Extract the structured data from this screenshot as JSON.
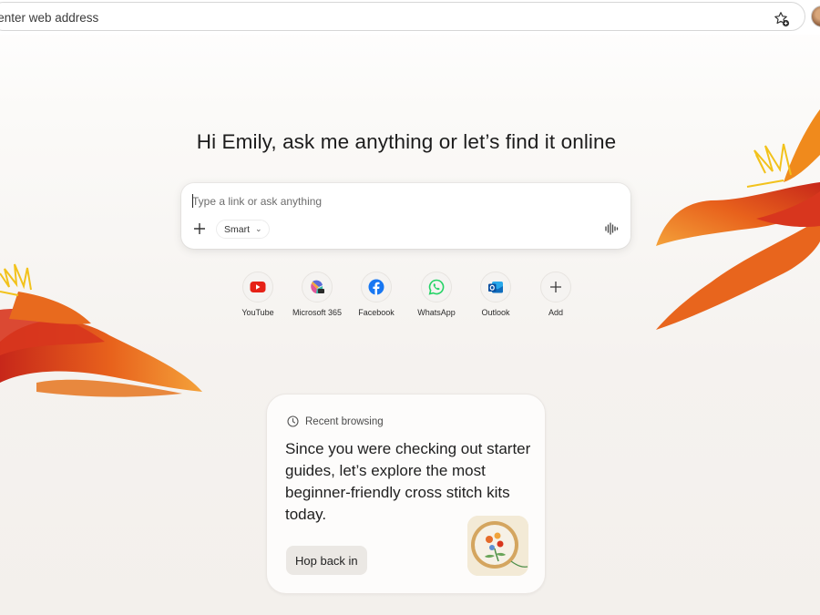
{
  "address_bar": {
    "text": "r enter web address"
  },
  "greeting": "Hi Emily, ask me anything or let’s find it online",
  "ask": {
    "placeholder": "Type a link or ask anything",
    "mode_label": "Smart"
  },
  "shortcuts": [
    {
      "label": "YouTube",
      "icon": "youtube-icon",
      "color": "#e62117"
    },
    {
      "label": "Microsoft 365",
      "icon": "microsoft-365-icon",
      "color": "#7b5cd6"
    },
    {
      "label": "Facebook",
      "icon": "facebook-icon",
      "color": "#1877f2"
    },
    {
      "label": "WhatsApp",
      "icon": "whatsapp-icon",
      "color": "#25d366"
    },
    {
      "label": "Outlook",
      "icon": "outlook-icon",
      "color": "#0f6cbd"
    },
    {
      "label": "Add",
      "icon": "plus-icon",
      "color": "#3a3a3a"
    }
  ],
  "recent": {
    "heading": "Recent browsing",
    "message": "Since you were checking out starter guides, let’s explore the most beginner-friendly cross stitch kits today.",
    "button_label": "Hop back in",
    "thumbnail_icon": "cross-stitch-hoop-icon"
  },
  "colors": {
    "flower_orange": "#f08a1c",
    "flower_red": "#d8361e"
  }
}
